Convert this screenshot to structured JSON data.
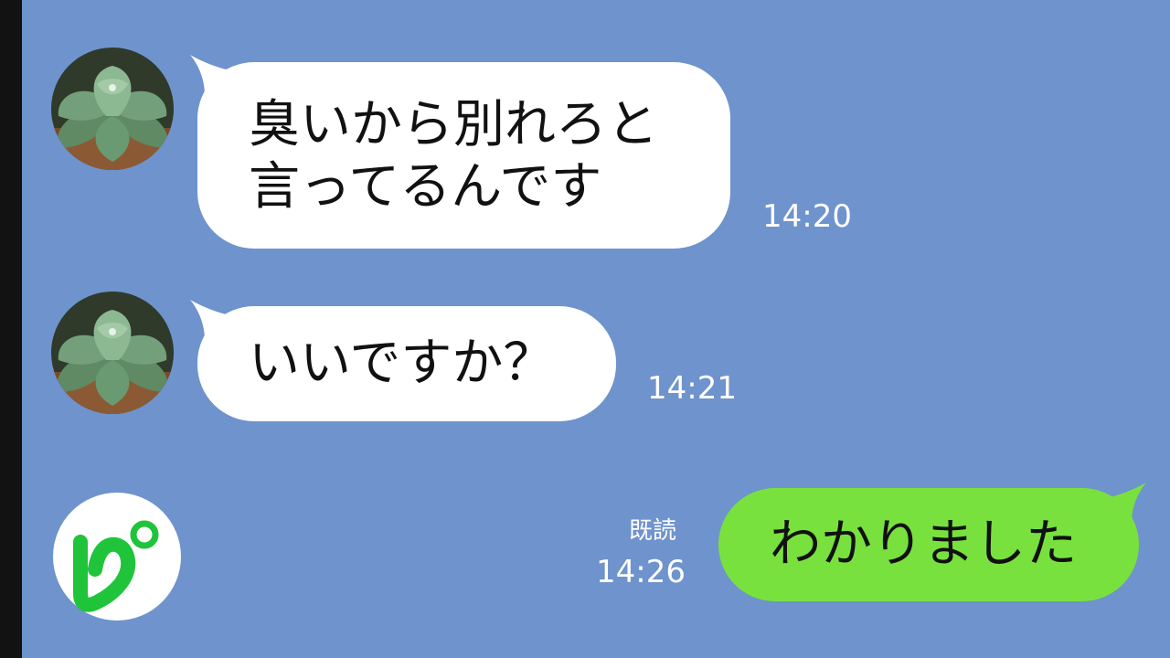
{
  "messages": [
    {
      "sender": "other",
      "lines": [
        "臭いから別れろと",
        "言ってるんです"
      ],
      "time": "14:20"
    },
    {
      "sender": "other",
      "lines": [
        "いいですか？"
      ],
      "time": "14:21"
    },
    {
      "sender": "self",
      "lines": [
        "わかりました"
      ],
      "time": "14:26",
      "read_label": "既読"
    }
  ],
  "icons": {
    "contact_avatar": "succulent-plant-avatar",
    "channel_logo": "pi-logo-icon"
  },
  "colors": {
    "background": "#6f93cc",
    "incoming_bubble": "#ffffff",
    "outgoing_bubble": "#79e13e",
    "logo_green": "#1fc43a"
  }
}
